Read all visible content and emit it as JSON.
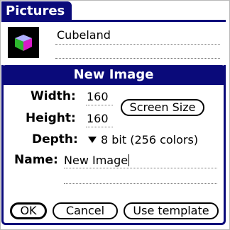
{
  "app": {
    "title": "Pictures"
  },
  "list": {
    "items": [
      {
        "name": "Cubeland",
        "icon": "cube-thumbnail-icon"
      }
    ]
  },
  "dialog": {
    "title": "New Image",
    "width_label": "Width:",
    "width_value": "160",
    "height_label": "Height:",
    "height_value": "160",
    "screen_size_label": "Screen Size",
    "depth_label": "Depth:",
    "depth_value": "8 bit (256 colors)",
    "name_label": "Name:",
    "name_value": "New Image",
    "ok_label": "OK",
    "cancel_label": "Cancel",
    "template_label": "Use template"
  },
  "colors": {
    "accent": "#0a0a7a",
    "background": "#ffffff"
  }
}
